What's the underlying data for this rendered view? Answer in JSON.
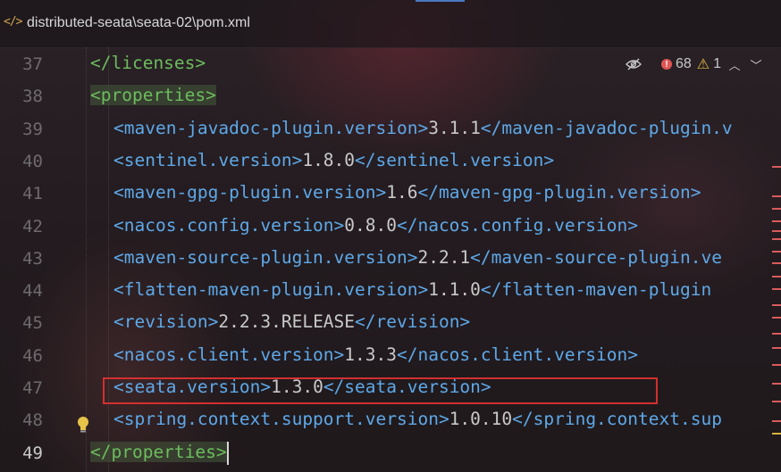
{
  "header": {
    "file_icon": "</>",
    "file_path": "distributed-seata\\seata-02\\pom.xml"
  },
  "inspections": {
    "errors": "68",
    "warnings": "1",
    "icons": [
      "eye-off-icon",
      "error-icon",
      "warning-icon",
      "chevron-up-icon",
      "chevron-down-icon"
    ]
  },
  "colors": {
    "tag": "#5ea8e8",
    "text": "#c9c9c9",
    "tag_match": "#6cbc5e",
    "highlight_box": "#d42f2f"
  },
  "lines": [
    {
      "no": "37",
      "indent": 1,
      "tag_green": "</licenses>"
    },
    {
      "no": "38",
      "indent": 1,
      "tag_green": "<properties>",
      "highlight": true
    },
    {
      "no": "39",
      "indent": 2,
      "open": "<maven-javadoc-plugin.version>",
      "value": "3.1.1",
      "close": "</maven-javadoc-plugin.v"
    },
    {
      "no": "40",
      "indent": 2,
      "open": "<sentinel.version>",
      "value": "1.8.0",
      "close": "</sentinel.version>"
    },
    {
      "no": "41",
      "indent": 2,
      "open": "<maven-gpg-plugin.version>",
      "value": "1.6",
      "close": "</maven-gpg-plugin.version>"
    },
    {
      "no": "42",
      "indent": 2,
      "open": "<nacos.config.version>",
      "value": "0.8.0",
      "close": "</nacos.config.version>"
    },
    {
      "no": "43",
      "indent": 2,
      "open": "<maven-source-plugin.version>",
      "value": "2.2.1",
      "close": "</maven-source-plugin.ve"
    },
    {
      "no": "44",
      "indent": 2,
      "open": "<flatten-maven-plugin.version>",
      "value": "1.1.0",
      "close": "</flatten-maven-plugin"
    },
    {
      "no": "45",
      "indent": 2,
      "open": "<revision>",
      "value": "2.2.3.RELEASE",
      "close": "</revision>"
    },
    {
      "no": "46",
      "indent": 2,
      "open": "<nacos.client.version>",
      "value": "1.3.3",
      "close": "</nacos.client.version>"
    },
    {
      "no": "47",
      "indent": 2,
      "open": "<seata.version>",
      "value": "1.3.0",
      "close": "</seata.version>"
    },
    {
      "no": "48",
      "indent": 2,
      "open": "<spring.context.support.version>",
      "value": "1.0.10",
      "close": "</spring.context.sup"
    },
    {
      "no": "49",
      "indent": 1,
      "tag_green": "</properties>",
      "highlight": true,
      "caret": true
    }
  ]
}
